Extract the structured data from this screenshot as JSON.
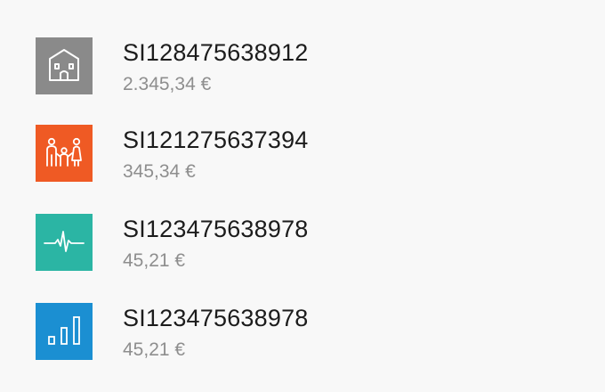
{
  "accounts": [
    {
      "iban": "SI128475638912",
      "amount": "2.345,34 €",
      "icon": "house-icon",
      "color": "#8a8a8a"
    },
    {
      "iban": "SI121275637394",
      "amount": "345,34 €",
      "icon": "family-icon",
      "color": "#ef5a24"
    },
    {
      "iban": "SI123475638978",
      "amount": "45,21 €",
      "icon": "heartbeat-icon",
      "color": "#2bb5a4"
    },
    {
      "iban": "SI123475638978",
      "amount": "45,21 €",
      "icon": "bar-chart-icon",
      "color": "#1b8fd2"
    }
  ]
}
